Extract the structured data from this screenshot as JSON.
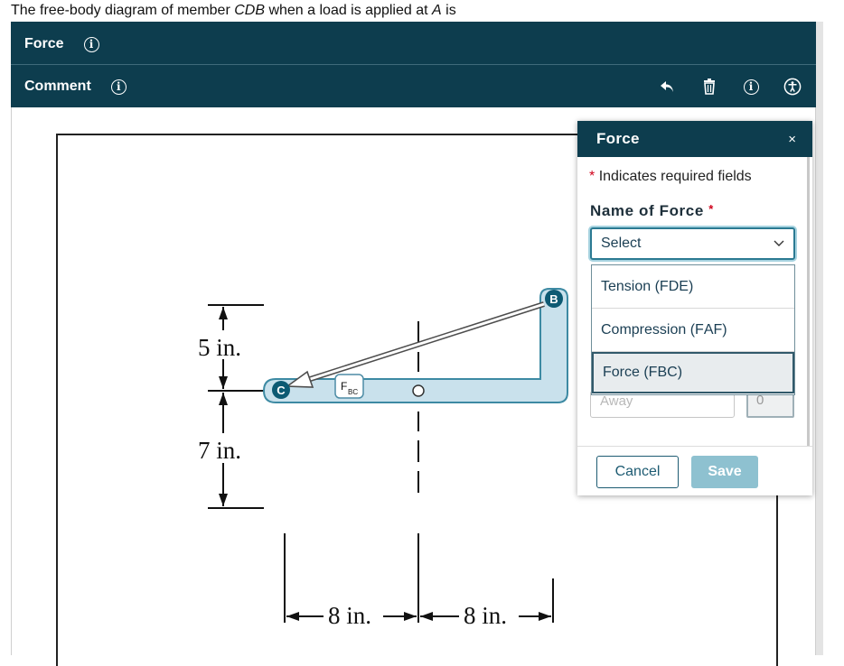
{
  "question": {
    "prefix": "The free-body diagram of member ",
    "member": "CDB",
    "middle": " when a load is applied at ",
    "point": "A",
    "suffix": " is"
  },
  "toolbar": {
    "force_label": "Force",
    "comment_label": "Comment",
    "icons": [
      "info-icon",
      "undo-icon",
      "trash-icon",
      "accessibility-icon"
    ]
  },
  "diagram": {
    "dim_5in": "5 in.",
    "dim_7in": "7 in.",
    "dim_8in_left": "8 in.",
    "dim_8in_right": "8 in.",
    "point_c": "C",
    "point_b": "B",
    "force_tag_main": "F",
    "force_tag_sub": "BC"
  },
  "panel": {
    "title": "Force",
    "close": "×",
    "required_note": "Indicates required fields",
    "required_star": "*",
    "name_label": "Name of Force",
    "select_value": "Select",
    "options": [
      {
        "main": "Tension (F",
        "sub": "DE",
        "end": ")"
      },
      {
        "main": "Compression (F",
        "sub": "AF",
        "end": ")"
      },
      {
        "main": "Force (F",
        "sub": "BC",
        "end": ")"
      }
    ],
    "away_text": "Away",
    "zero_text": "0",
    "cancel_label": "Cancel",
    "save_label": "Save"
  },
  "colors": {
    "header_bg": "#0d3d4e",
    "accent": "#2b7a92",
    "save_disabled": "#8ec1d0",
    "required": "#d0021b",
    "member_fill": "#c9e1ec",
    "member_stroke": "#3d8aa3"
  }
}
